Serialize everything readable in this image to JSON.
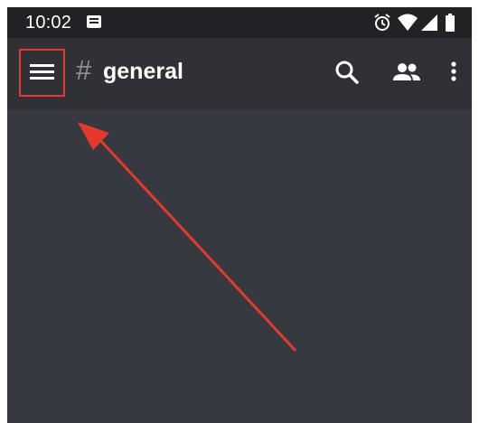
{
  "status_bar": {
    "time": "10:02",
    "icons": [
      "message-notification-icon",
      "alarm-icon",
      "wifi-icon",
      "cellular-signal-icon",
      "battery-icon"
    ]
  },
  "app_bar": {
    "channel_prefix": "#",
    "channel_name": "general",
    "actions": [
      "search-icon",
      "members-icon",
      "more-vert-icon"
    ]
  },
  "annotation": {
    "highlight_target": "menu-button",
    "color": "#e53a2a"
  },
  "colors": {
    "status_bar_bg": "#202225",
    "app_bar_bg": "#2f3136",
    "content_bg": "#36393f"
  }
}
